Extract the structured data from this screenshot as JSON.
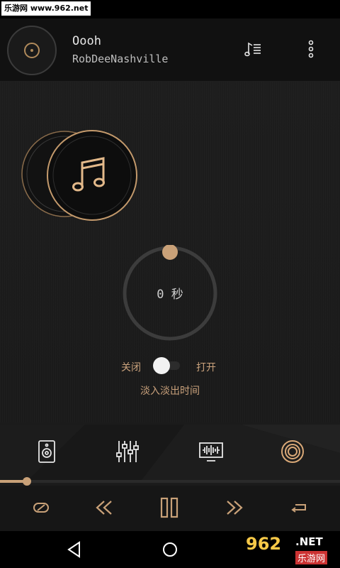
{
  "status_bar": {
    "watermark": "乐游网 www.962.net"
  },
  "header": {
    "song_title": "Oooh",
    "artist": "RobDeeNashville",
    "playlist_icon": "playlist-icon",
    "more_icon": "more-vert-icon"
  },
  "fade": {
    "value_text": "0 秒",
    "value_fraction": 0,
    "off_label": "关闭",
    "on_label": "打开",
    "toggle_on": false,
    "label": "淡入淡出时间"
  },
  "tabs": [
    {
      "icon": "speaker-icon"
    },
    {
      "icon": "equalizer-sliders-icon"
    },
    {
      "icon": "visualizer-icon"
    },
    {
      "icon": "disc-mode-icon",
      "active": true
    }
  ],
  "playback": {
    "progress_fraction": 0.08,
    "shuffle_icon": "loop-icon",
    "prev_icon": "rewind-icon",
    "play_pause_icon": "pause-icon",
    "next_icon": "fast-forward-icon",
    "repeat_icon": "repeat-icon"
  },
  "navbar": {
    "back_icon": "back-triangle-icon",
    "home_icon": "home-circle-icon"
  },
  "logo": {
    "number": "962",
    "net": ".NET",
    "cn": "乐游网"
  },
  "colors": {
    "accent": "#c9a178",
    "background": "#1b1b1b"
  }
}
